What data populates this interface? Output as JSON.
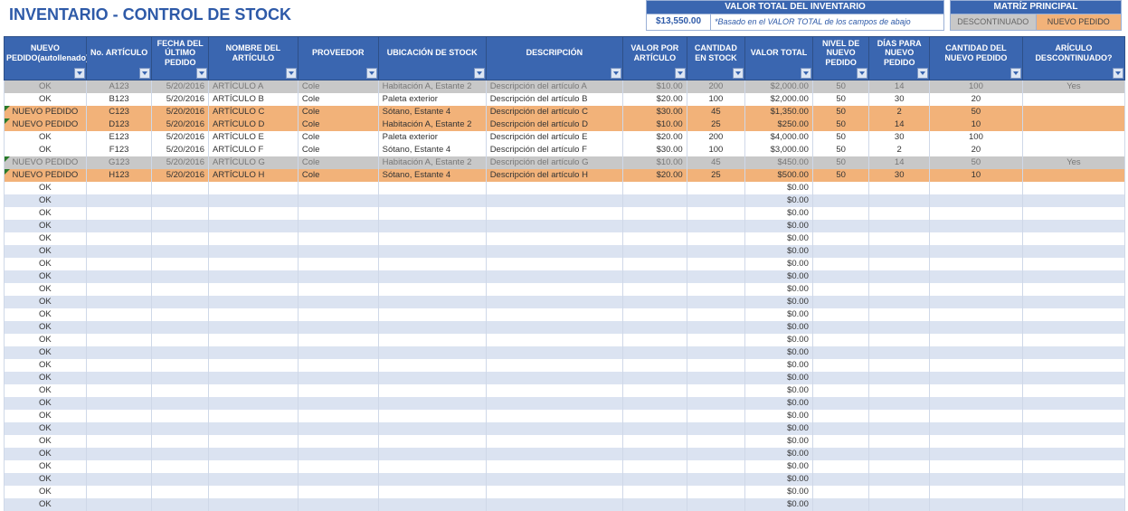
{
  "title": "INVENTARIO - CONTROL DE STOCK",
  "total_inventory": {
    "header": "VALOR TOTAL DEL INVENTARIO",
    "value": "$13,550.00",
    "note": "*Basado en el VALOR TOTAL de los campos de abajo"
  },
  "legend": {
    "header": "MATRÍZ PRINCIPAL",
    "discontinued": "DESCONTINUADO",
    "reorder": "NUEVO PEDIDO"
  },
  "columns": [
    "NUEVO PEDIDO(autollenado)",
    "No. ARTÍCULO",
    "FECHA DEL ÚLTIMO PEDIDO",
    "NOMBRE DEL ARTÍCULO",
    "PROVEEDOR",
    "UBICACIÓN DE STOCK",
    "DESCRIPCIÓN",
    "VALOR POR ARTÍCULO",
    "CANTIDAD EN STOCK",
    "VALOR TOTAL",
    "NIVEL DE NUEVO PEDIDO",
    "DÍAS PARA NUEVO PEDIDO",
    "CANTIDAD DEL NUEVO PEDIDO",
    "ARÍCULO DESCONTINUADO?"
  ],
  "rows": [
    {
      "status": "OK",
      "style": "disc",
      "flag": false,
      "item_no": "A123",
      "date": "5/20/2016",
      "name": "ARTÍCULO A",
      "vendor": "Cole",
      "location": "Habitación A, Estante 2",
      "desc": "Descripción del artículo A",
      "unit_cost": "$10.00",
      "qty": "200",
      "total": "$2,000.00",
      "reorder_level": "50",
      "days": "14",
      "reorder_qty": "100",
      "discontinued": "Yes"
    },
    {
      "status": "OK",
      "style": "band",
      "flag": false,
      "item_no": "B123",
      "date": "5/20/2016",
      "name": "ARTÍCULO B",
      "vendor": "Cole",
      "location": "Paleta exterior",
      "desc": "Descripción del artículo B",
      "unit_cost": "$20.00",
      "qty": "100",
      "total": "$2,000.00",
      "reorder_level": "50",
      "days": "30",
      "reorder_qty": "20",
      "discontinued": ""
    },
    {
      "status": "NUEVO PEDIDO",
      "style": "reorder",
      "flag": true,
      "item_no": "C123",
      "date": "5/20/2016",
      "name": "ARTÍCULO C",
      "vendor": "Cole",
      "location": "Sótano, Estante 4",
      "desc": "Descripción del artículo C",
      "unit_cost": "$30.00",
      "qty": "45",
      "total": "$1,350.00",
      "reorder_level": "50",
      "days": "2",
      "reorder_qty": "50",
      "discontinued": ""
    },
    {
      "status": "NUEVO PEDIDO",
      "style": "reorder",
      "flag": true,
      "item_no": "D123",
      "date": "5/20/2016",
      "name": "ARTÍCULO D",
      "vendor": "Cole",
      "location": "Habitación A, Estante 2",
      "desc": "Descripción del artículo D",
      "unit_cost": "$10.00",
      "qty": "25",
      "total": "$250.00",
      "reorder_level": "50",
      "days": "14",
      "reorder_qty": "10",
      "discontinued": ""
    },
    {
      "status": "OK",
      "style": "plain",
      "flag": false,
      "item_no": "E123",
      "date": "5/20/2016",
      "name": "ARTÍCULO E",
      "vendor": "Cole",
      "location": "Paleta exterior",
      "desc": "Descripción del artículo E",
      "unit_cost": "$20.00",
      "qty": "200",
      "total": "$4,000.00",
      "reorder_level": "50",
      "days": "30",
      "reorder_qty": "100",
      "discontinued": ""
    },
    {
      "status": "OK",
      "style": "band",
      "flag": false,
      "item_no": "F123",
      "date": "5/20/2016",
      "name": "ARTÍCULO F",
      "vendor": "Cole",
      "location": "Sótano, Estante 4",
      "desc": "Descripción del artículo F",
      "unit_cost": "$30.00",
      "qty": "100",
      "total": "$3,000.00",
      "reorder_level": "50",
      "days": "2",
      "reorder_qty": "20",
      "discontinued": ""
    },
    {
      "status": "NUEVO PEDIDO",
      "style": "disc",
      "flag": true,
      "item_no": "G123",
      "date": "5/20/2016",
      "name": "ARTÍCULO G",
      "vendor": "Cole",
      "location": "Habitación A, Estante 2",
      "desc": "Descripción del artículo G",
      "unit_cost": "$10.00",
      "qty": "45",
      "total": "$450.00",
      "reorder_level": "50",
      "days": "14",
      "reorder_qty": "50",
      "discontinued": "Yes"
    },
    {
      "status": "NUEVO PEDIDO",
      "style": "reorder",
      "flag": true,
      "item_no": "H123",
      "date": "5/20/2016",
      "name": "ARTÍCULO H",
      "vendor": "Cole",
      "location": "Sótano, Estante 4",
      "desc": "Descripción del artículo H",
      "unit_cost": "$20.00",
      "qty": "25",
      "total": "$500.00",
      "reorder_level": "50",
      "days": "30",
      "reorder_qty": "10",
      "discontinued": ""
    }
  ],
  "empty_row": {
    "status": "OK",
    "total": "$0.00"
  },
  "empty_row_count": 26
}
